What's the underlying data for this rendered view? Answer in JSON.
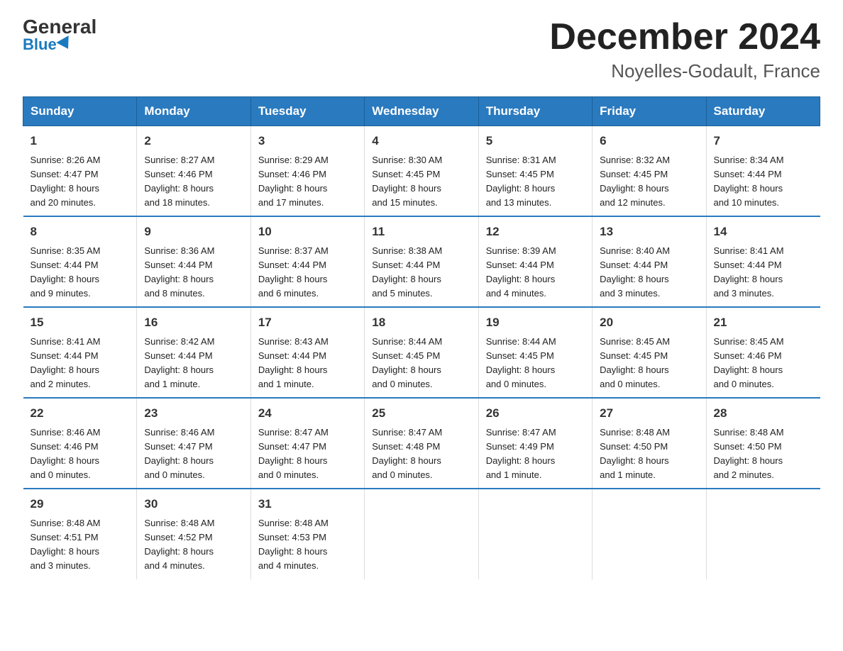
{
  "header": {
    "logo_general": "General",
    "logo_blue": "Blue",
    "month": "December 2024",
    "location": "Noyelles-Godault, France"
  },
  "weekdays": [
    "Sunday",
    "Monday",
    "Tuesday",
    "Wednesday",
    "Thursday",
    "Friday",
    "Saturday"
  ],
  "weeks": [
    [
      {
        "day": "1",
        "sunrise": "8:26 AM",
        "sunset": "4:47 PM",
        "daylight": "8 hours and 20 minutes."
      },
      {
        "day": "2",
        "sunrise": "8:27 AM",
        "sunset": "4:46 PM",
        "daylight": "8 hours and 18 minutes."
      },
      {
        "day": "3",
        "sunrise": "8:29 AM",
        "sunset": "4:46 PM",
        "daylight": "8 hours and 17 minutes."
      },
      {
        "day": "4",
        "sunrise": "8:30 AM",
        "sunset": "4:45 PM",
        "daylight": "8 hours and 15 minutes."
      },
      {
        "day": "5",
        "sunrise": "8:31 AM",
        "sunset": "4:45 PM",
        "daylight": "8 hours and 13 minutes."
      },
      {
        "day": "6",
        "sunrise": "8:32 AM",
        "sunset": "4:45 PM",
        "daylight": "8 hours and 12 minutes."
      },
      {
        "day": "7",
        "sunrise": "8:34 AM",
        "sunset": "4:44 PM",
        "daylight": "8 hours and 10 minutes."
      }
    ],
    [
      {
        "day": "8",
        "sunrise": "8:35 AM",
        "sunset": "4:44 PM",
        "daylight": "8 hours and 9 minutes."
      },
      {
        "day": "9",
        "sunrise": "8:36 AM",
        "sunset": "4:44 PM",
        "daylight": "8 hours and 8 minutes."
      },
      {
        "day": "10",
        "sunrise": "8:37 AM",
        "sunset": "4:44 PM",
        "daylight": "8 hours and 6 minutes."
      },
      {
        "day": "11",
        "sunrise": "8:38 AM",
        "sunset": "4:44 PM",
        "daylight": "8 hours and 5 minutes."
      },
      {
        "day": "12",
        "sunrise": "8:39 AM",
        "sunset": "4:44 PM",
        "daylight": "8 hours and 4 minutes."
      },
      {
        "day": "13",
        "sunrise": "8:40 AM",
        "sunset": "4:44 PM",
        "daylight": "8 hours and 3 minutes."
      },
      {
        "day": "14",
        "sunrise": "8:41 AM",
        "sunset": "4:44 PM",
        "daylight": "8 hours and 3 minutes."
      }
    ],
    [
      {
        "day": "15",
        "sunrise": "8:41 AM",
        "sunset": "4:44 PM",
        "daylight": "8 hours and 2 minutes."
      },
      {
        "day": "16",
        "sunrise": "8:42 AM",
        "sunset": "4:44 PM",
        "daylight": "8 hours and 1 minute."
      },
      {
        "day": "17",
        "sunrise": "8:43 AM",
        "sunset": "4:44 PM",
        "daylight": "8 hours and 1 minute."
      },
      {
        "day": "18",
        "sunrise": "8:44 AM",
        "sunset": "4:45 PM",
        "daylight": "8 hours and 0 minutes."
      },
      {
        "day": "19",
        "sunrise": "8:44 AM",
        "sunset": "4:45 PM",
        "daylight": "8 hours and 0 minutes."
      },
      {
        "day": "20",
        "sunrise": "8:45 AM",
        "sunset": "4:45 PM",
        "daylight": "8 hours and 0 minutes."
      },
      {
        "day": "21",
        "sunrise": "8:45 AM",
        "sunset": "4:46 PM",
        "daylight": "8 hours and 0 minutes."
      }
    ],
    [
      {
        "day": "22",
        "sunrise": "8:46 AM",
        "sunset": "4:46 PM",
        "daylight": "8 hours and 0 minutes."
      },
      {
        "day": "23",
        "sunrise": "8:46 AM",
        "sunset": "4:47 PM",
        "daylight": "8 hours and 0 minutes."
      },
      {
        "day": "24",
        "sunrise": "8:47 AM",
        "sunset": "4:47 PM",
        "daylight": "8 hours and 0 minutes."
      },
      {
        "day": "25",
        "sunrise": "8:47 AM",
        "sunset": "4:48 PM",
        "daylight": "8 hours and 0 minutes."
      },
      {
        "day": "26",
        "sunrise": "8:47 AM",
        "sunset": "4:49 PM",
        "daylight": "8 hours and 1 minute."
      },
      {
        "day": "27",
        "sunrise": "8:48 AM",
        "sunset": "4:50 PM",
        "daylight": "8 hours and 1 minute."
      },
      {
        "day": "28",
        "sunrise": "8:48 AM",
        "sunset": "4:50 PM",
        "daylight": "8 hours and 2 minutes."
      }
    ],
    [
      {
        "day": "29",
        "sunrise": "8:48 AM",
        "sunset": "4:51 PM",
        "daylight": "8 hours and 3 minutes."
      },
      {
        "day": "30",
        "sunrise": "8:48 AM",
        "sunset": "4:52 PM",
        "daylight": "8 hours and 4 minutes."
      },
      {
        "day": "31",
        "sunrise": "8:48 AM",
        "sunset": "4:53 PM",
        "daylight": "8 hours and 4 minutes."
      },
      null,
      null,
      null,
      null
    ]
  ],
  "labels": {
    "sunrise": "Sunrise:",
    "sunset": "Sunset:",
    "daylight": "Daylight:"
  }
}
